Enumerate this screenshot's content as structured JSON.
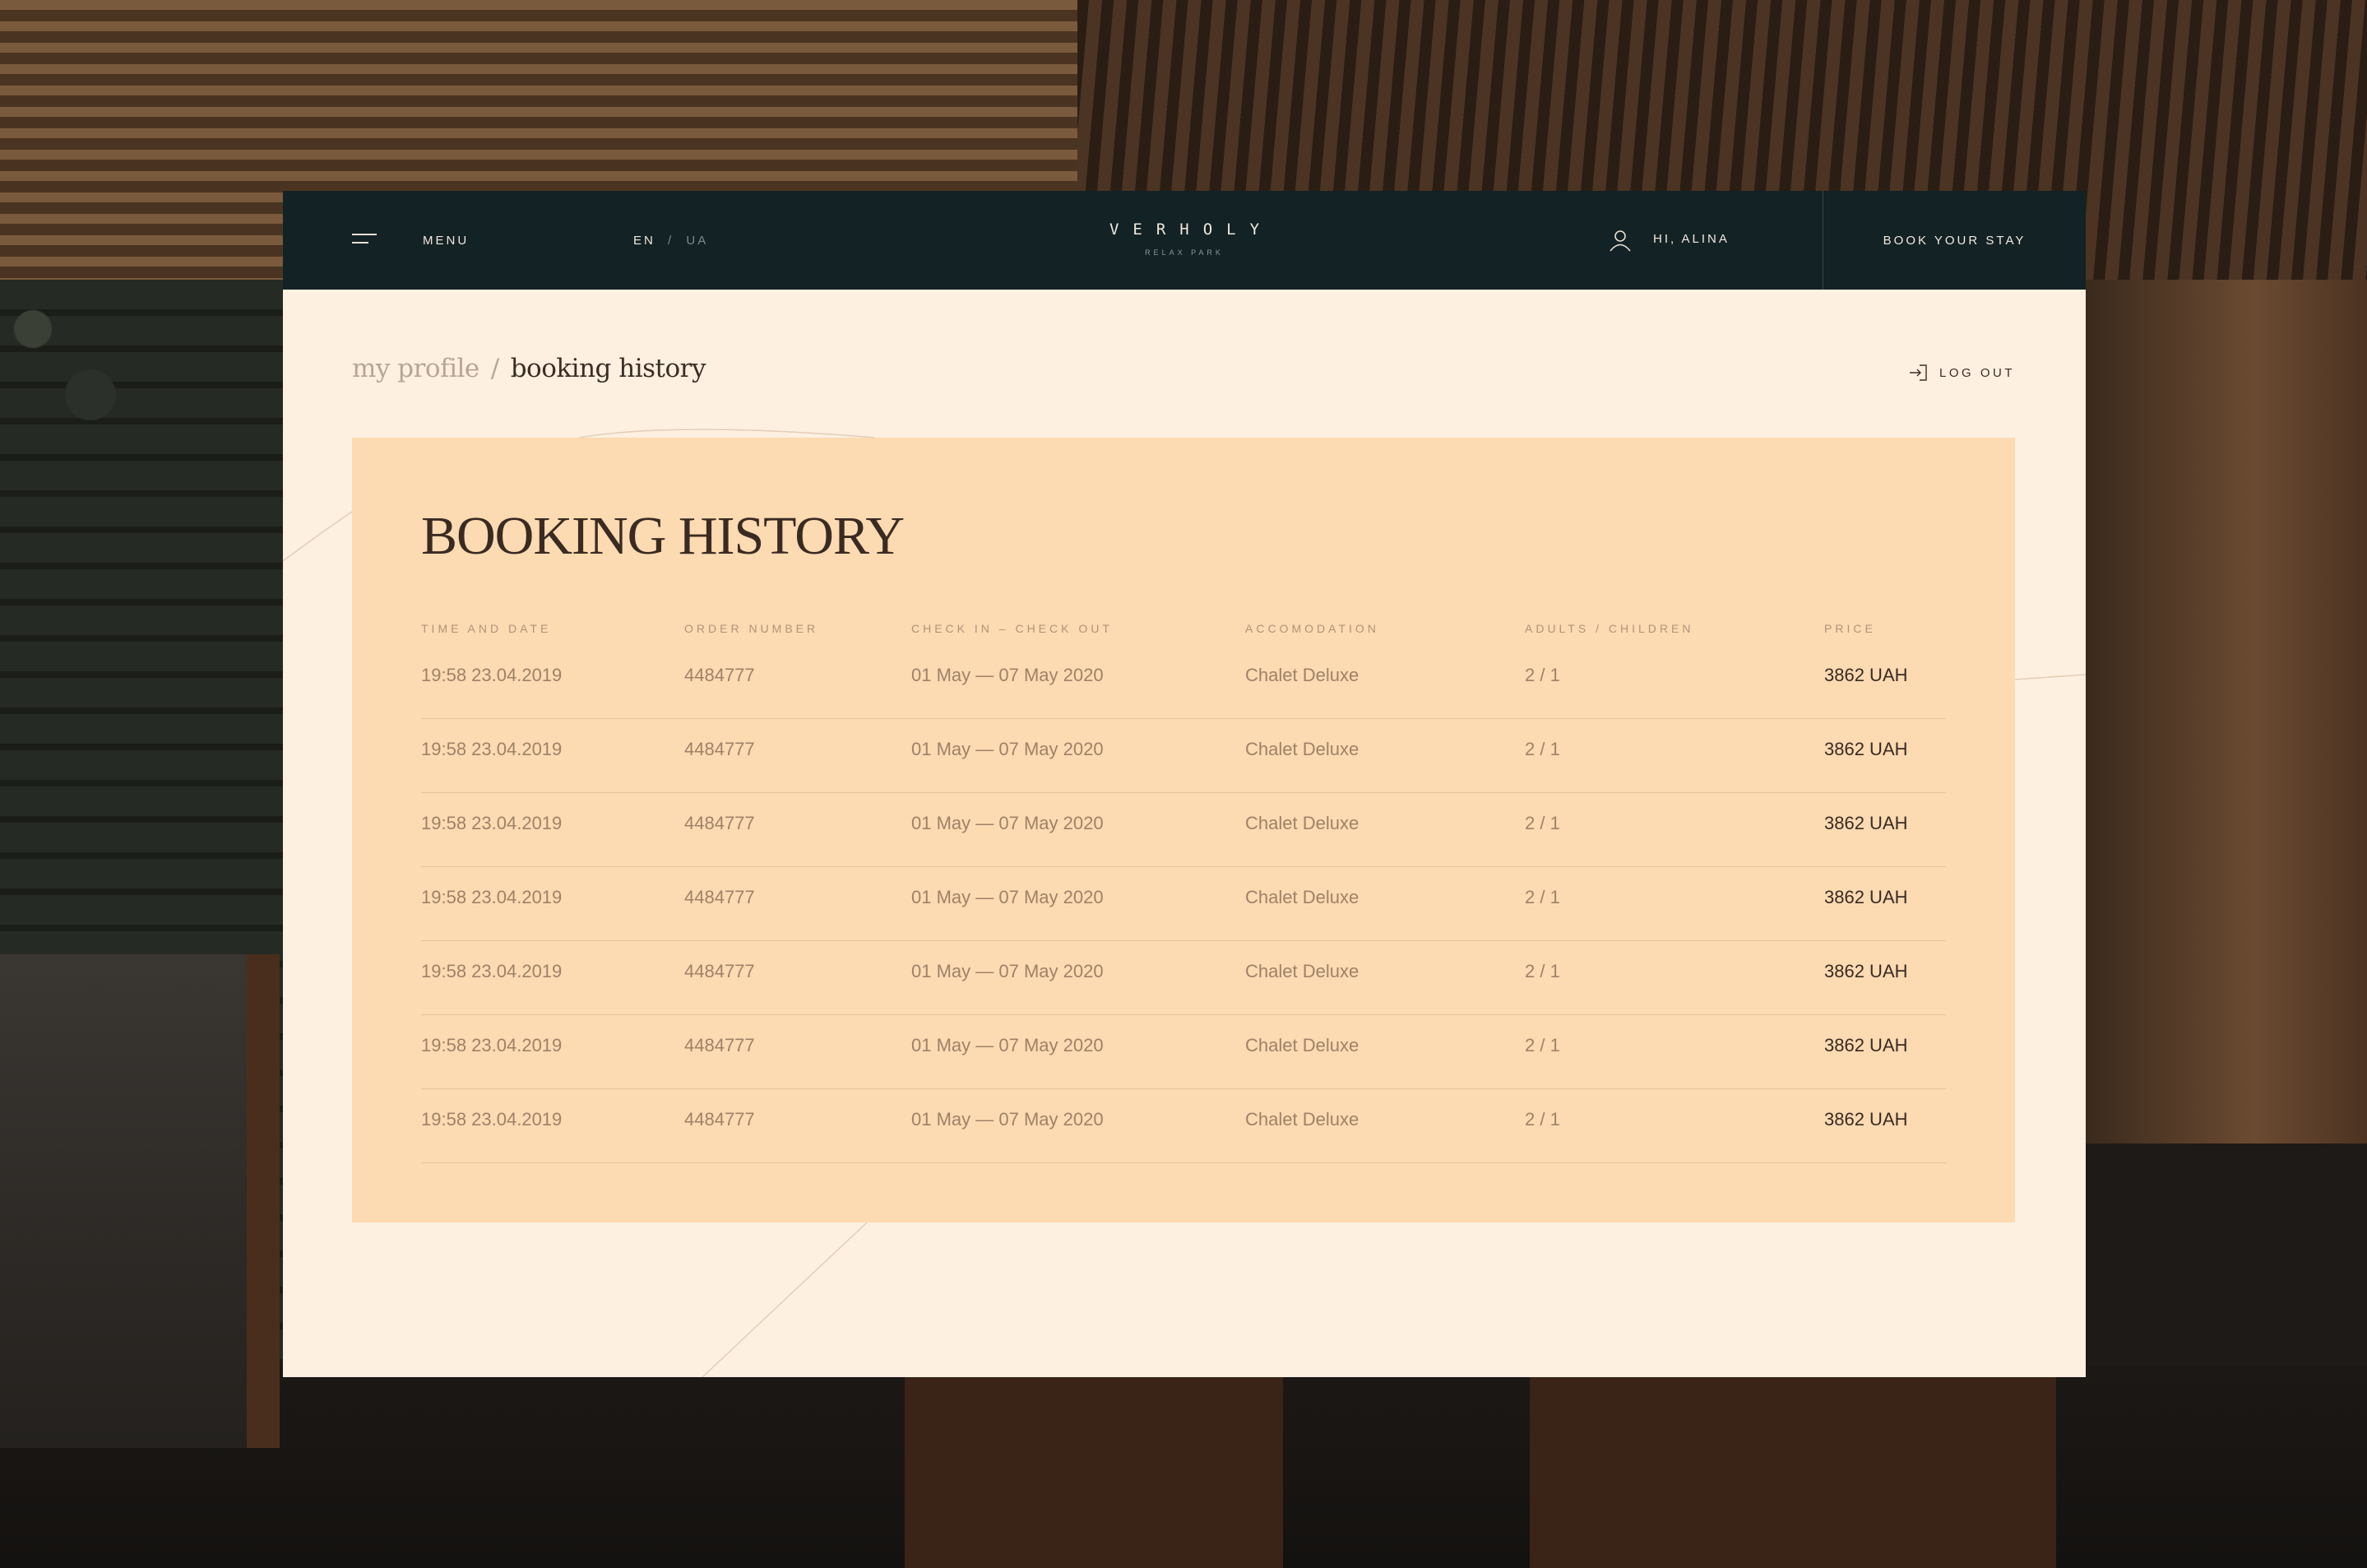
{
  "header": {
    "menu_label": "MENU",
    "lang_active": "EN",
    "lang_separator": "/",
    "lang_inactive": "UA",
    "logo": "VERHOLY",
    "logo_sub": "RELAX PARK",
    "greeting": "HI, ALINA",
    "book_label": "BOOK YOUR STAY"
  },
  "breadcrumb": {
    "parent": "my profile",
    "separator": "/",
    "current": "booking history"
  },
  "logout_label": "LOG OUT",
  "card": {
    "title": "BOOKING HISTORY",
    "columns": [
      "TIME AND DATE",
      "ORDER NUMBER",
      "CHECK IN – CHECK OUT",
      "ACCOMODATION",
      "ADULTS / CHILDREN",
      "PRICE"
    ],
    "rows": [
      [
        "19:58 23.04.2019",
        "4484777",
        "01 May — 07 May 2020",
        "Chalet Deluxe",
        "2 / 1",
        "3862 UAH"
      ],
      [
        "19:58 23.04.2019",
        "4484777",
        "01 May — 07 May 2020",
        "Chalet Deluxe",
        "2 / 1",
        "3862 UAH"
      ],
      [
        "19:58 23.04.2019",
        "4484777",
        "01 May — 07 May 2020",
        "Chalet Deluxe",
        "2 / 1",
        "3862 UAH"
      ],
      [
        "19:58 23.04.2019",
        "4484777",
        "01 May — 07 May 2020",
        "Chalet Deluxe",
        "2 / 1",
        "3862 UAH"
      ],
      [
        "19:58 23.04.2019",
        "4484777",
        "01 May — 07 May 2020",
        "Chalet Deluxe",
        "2 / 1",
        "3862 UAH"
      ],
      [
        "19:58 23.04.2019",
        "4484777",
        "01 May — 07 May 2020",
        "Chalet Deluxe",
        "2 / 1",
        "3862 UAH"
      ],
      [
        "19:58 23.04.2019",
        "4484777",
        "01 May — 07 May 2020",
        "Chalet Deluxe",
        "2 / 1",
        "3862 UAH"
      ]
    ]
  },
  "icons": {
    "menu": "hamburger-icon",
    "user": "user-icon",
    "logout": "logout-icon"
  },
  "colors": {
    "topbar": "#132224",
    "panel": "#fdf0e1",
    "card": "#fcdab2",
    "text_dark": "#3a2b22",
    "text_muted": "#9e8268"
  }
}
